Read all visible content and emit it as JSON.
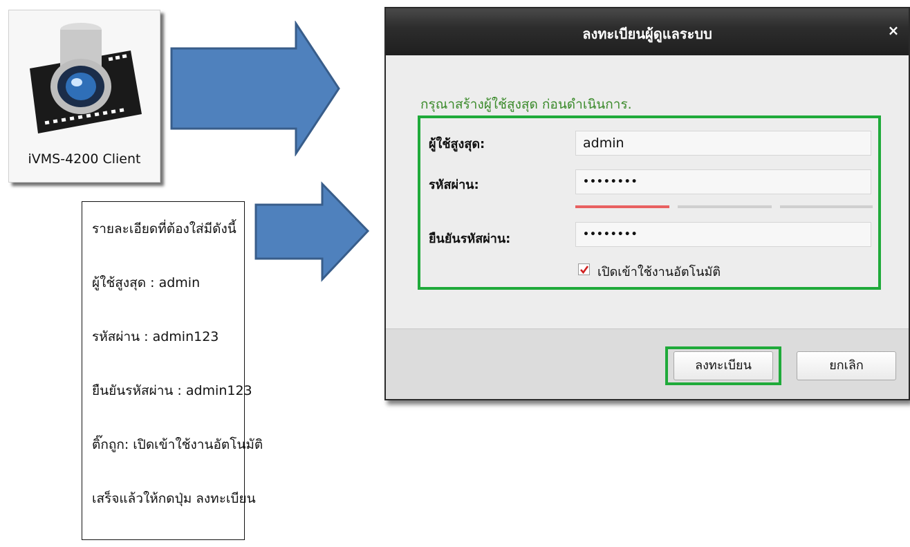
{
  "app_icon": {
    "label": "iVMS-4200 Client"
  },
  "instructions": {
    "lines": [
      "รายละเอียดที่ต้องใส่มีดังนี้",
      "ผู้ใช้สูงสุด : admin",
      "รหัสผ่าน : admin123",
      "ยืนยันรหัสผ่าน : admin123",
      "ติ๊กถูก: เปิดเข้าใช้งานอัตโนมัติ",
      "เสร็จแล้วให้กดปุ่ม ลงทะเบียน"
    ]
  },
  "dialog": {
    "title": "ลงทะเบียนผู้ดูแลระบบ",
    "close_glyph": "×",
    "hint": "กรุณาสร้างผู้ใช้สูงสุด ก่อนดำเนินการ.",
    "fields": {
      "user_label": "ผู้ใช้สูงสุด:",
      "user_value": "admin",
      "password_label": "รหัสผ่าน:",
      "password_value": "••••••••",
      "confirm_label": "ยืนยันรหัสผ่าน:",
      "confirm_value": "••••••••"
    },
    "password_strength": {
      "level": 1,
      "of": 3,
      "colors": [
        "#e86060",
        "#cfcfcf",
        "#cfcfcf"
      ]
    },
    "auto_login": {
      "label": "เปิดเข้าใช้งานอัตโนมัติ",
      "checked": true
    },
    "buttons": {
      "register": "ลงทะเบียน",
      "cancel": "ยกเลิก"
    }
  },
  "colors": {
    "highlight_green": "#1faa3a",
    "arrow_fill": "#4f81bd",
    "arrow_stroke": "#385d8a",
    "hint_green": "#3a8a2a"
  }
}
